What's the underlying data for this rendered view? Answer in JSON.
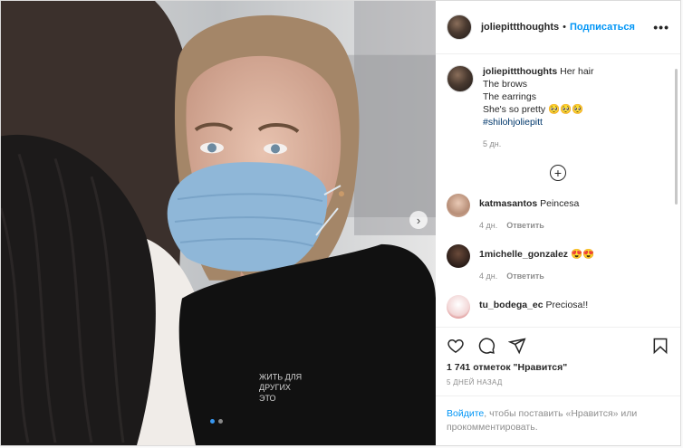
{
  "post": {
    "username": "joliepittthoughts",
    "separator": "•",
    "follow_label": "Подписаться",
    "more_label": "•••",
    "caption": {
      "username": "joliepittthoughts",
      "lines": [
        "Her hair",
        "The brows",
        "The earrings",
        "She's so pretty 🥺🥺🥺"
      ],
      "hashtag": "#shilohjoliepitt",
      "time": "5 дн."
    },
    "load_more_label": "+",
    "comments": [
      {
        "username": "katmasantos",
        "text": "Peincesa",
        "time": "4 дн.",
        "reply": "Ответить"
      },
      {
        "username": "1michelle_gonzalez",
        "text": "😍😍",
        "time": "4 дн.",
        "reply": "Ответить"
      },
      {
        "username": "tu_bodega_ec",
        "text": "Preciosa!!",
        "time": "",
        "reply": ""
      }
    ],
    "likes": "1 741 отметок \"Нравится\"",
    "time_ago": "5 ДНЕЙ НАЗАД",
    "login": {
      "link": "Войдите",
      "text": ", чтобы поставить «Нравится» или прокомментировать."
    }
  },
  "media": {
    "carousel_count": 2,
    "active_index": 0
  },
  "icons": [
    "heart-icon",
    "comment-icon",
    "share-icon",
    "save-icon",
    "next-arrow-icon",
    "add-circle-icon"
  ],
  "colors": {
    "link": "#0095f6",
    "hashtag": "#00376b",
    "muted": "#8e8e8e",
    "border": "#dbdbdb",
    "active_dot": "#3897f0"
  }
}
